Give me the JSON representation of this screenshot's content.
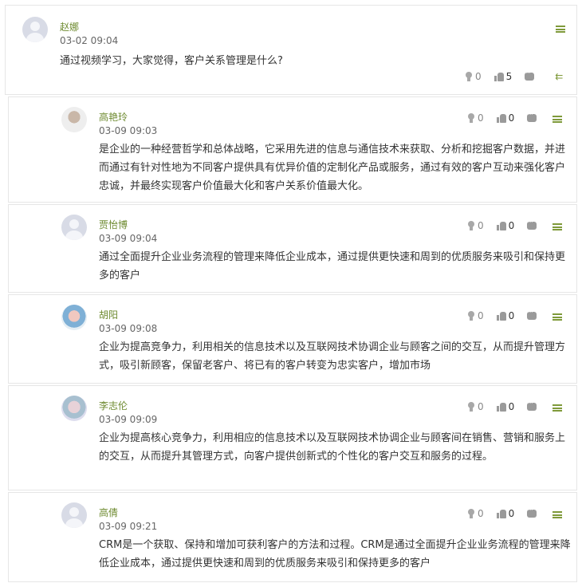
{
  "thread": {
    "main_post": {
      "author": "赵娜",
      "date": "03-02 09:04",
      "content": "通过视频学习，大家觉得，客户关系管理是什么?",
      "tips": "0",
      "likes": "5"
    },
    "replies": [
      {
        "author": "高艳玲",
        "date": "03-09 09:03",
        "content": "是企业的一种经营哲学和总体战略，它采用先进的信息与通信技术来获取、分析和挖掘客户数据，并进而通过有针对性地为不同客户提供具有优异价值的定制化产品或服务，通过有效的客户互动来强化客户忠诚，并最终实现客户价值最大化和客户关系价值最大化。",
        "tips": "0",
        "likes": "0"
      },
      {
        "author": "贾怡博",
        "date": "03-09 09:04",
        "content": "通过全面提升企业业务流程的管理来降低企业成本，通过提供更快速和周到的优质服务来吸引和保持更多的客户",
        "tips": "0",
        "likes": "0"
      },
      {
        "author": "胡阳",
        "date": "03-09 09:08",
        "content": "企业为提高竞争力，利用相关的信息技术以及互联网技术协调企业与顾客之间的交互，从而提升管理方式，吸引新顾客，保留老客户、将已有的客户转变为忠实客户，增加市场",
        "tips": "0",
        "likes": "0"
      },
      {
        "author": "李志伦",
        "date": "03-09 09:09",
        "content": "企业为提高核心竞争力，利用相应的信息技术以及互联网技术协调企业与顾客间在销售、营销和服务上的交互，从而提升其管理方式，向客户提供创新式的个性化的客户交互和服务的过程。",
        "tips": "0",
        "likes": "0"
      },
      {
        "author": "高倩",
        "date": "03-09 09:21",
        "content": "CRM是一个获取、保持和增加可获利客户的方法和过程。CRM是通过全面提升企业业务流程的管理来降低企业成本，通过提供更快速和周到的优质服务来吸引和保持更多的客户",
        "tips": "0",
        "likes": "0"
      }
    ]
  },
  "colors": {
    "name": "#6d8a2f",
    "accent": "#7f9a3a",
    "border": "#e6e6e6"
  },
  "icons": {
    "avatar": "user-avatar-icon",
    "menu": "menu-icon",
    "tip": "lightbulb-icon",
    "like": "thumbs-up-icon",
    "comment": "comment-icon",
    "reply": "reply-icon"
  }
}
